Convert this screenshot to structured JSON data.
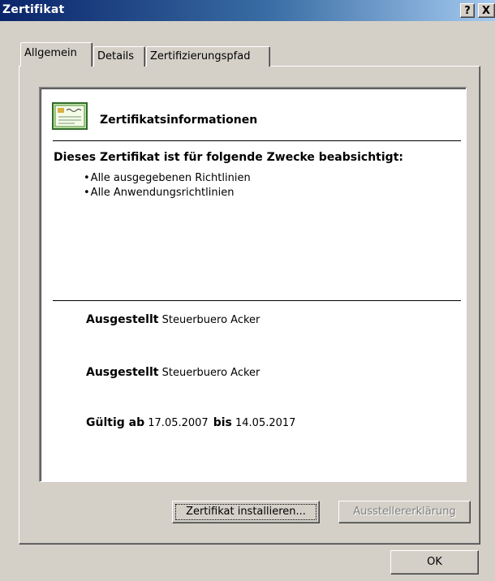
{
  "window": {
    "title": "Zertifikat",
    "help_label": "?",
    "close_label": "X"
  },
  "tabs": [
    "Allgemein",
    "Details",
    "Zertifizierungspfad"
  ],
  "info": {
    "title": "Zertifikatsinformationen",
    "purpose_heading": "Dieses Zertifikat ist für folgende Zwecke beabsichtigt:",
    "purposes": [
      "Alle ausgegebenen Richtlinien",
      "Alle Anwendungsrichtlinien"
    ],
    "issued_to_label": "Ausgestellt",
    "issued_to_value": "Steuerbuero Acker",
    "issued_by_label": "Ausgestellt",
    "issued_by_value": "Steuerbuero Acker",
    "valid_from_label": "Gültig ab",
    "valid_from": "17.05.2007",
    "valid_to_label": "bis",
    "valid_to": "14.05.2017"
  },
  "buttons": {
    "install": "Zertifikat installieren...",
    "issuer_statement": "Ausstellererklärung",
    "ok": "OK"
  },
  "colors": {
    "titlebar_start": "#0a246a",
    "titlebar_end": "#a6caf0",
    "face": "#d4d0c8"
  },
  "icons": {
    "certificate": "certificate-icon"
  }
}
